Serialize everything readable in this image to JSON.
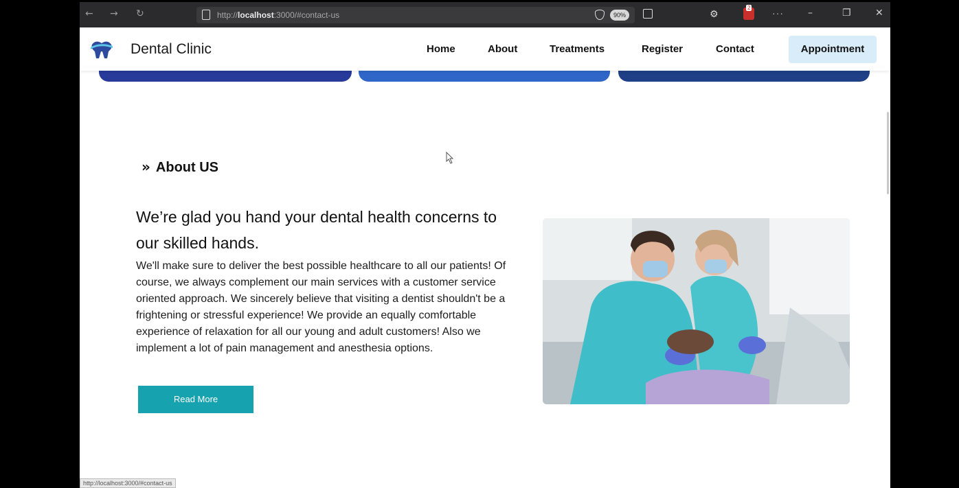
{
  "browser": {
    "url_prefix": "http://",
    "url_host": "localhost",
    "url_rest": ":3000/#contact-us",
    "zoom": "90%",
    "notification_count": "2",
    "status_url": "http://localhost:3000/#contact-us"
  },
  "site": {
    "brand": "Dental Clinic",
    "nav": [
      "Home",
      "About",
      "Treatments",
      "Register",
      "Contact"
    ],
    "cta": "Appointment"
  },
  "about": {
    "kicker": "About US",
    "headline": "We’re glad you hand your dental health concerns to our skilled hands.",
    "body": "We'll make sure to deliver the best possible healthcare to all our patients! Of course, we always complement our main services with a customer service oriented approach. We sincerely believe that visiting a dentist shouldn't be a frightening or stressful experience! We provide an equally comfortable experience of relaxation for all our young and adult customers! Also we implement a lot of pain management and anesthesia options.",
    "button": "Read More"
  },
  "colors": {
    "accent": "#17a2b0",
    "cta_bg": "#d8ecfa",
    "card_blue_1": "#283a9a",
    "card_blue_2": "#2f66c8",
    "card_blue_3": "#1f3f86"
  }
}
